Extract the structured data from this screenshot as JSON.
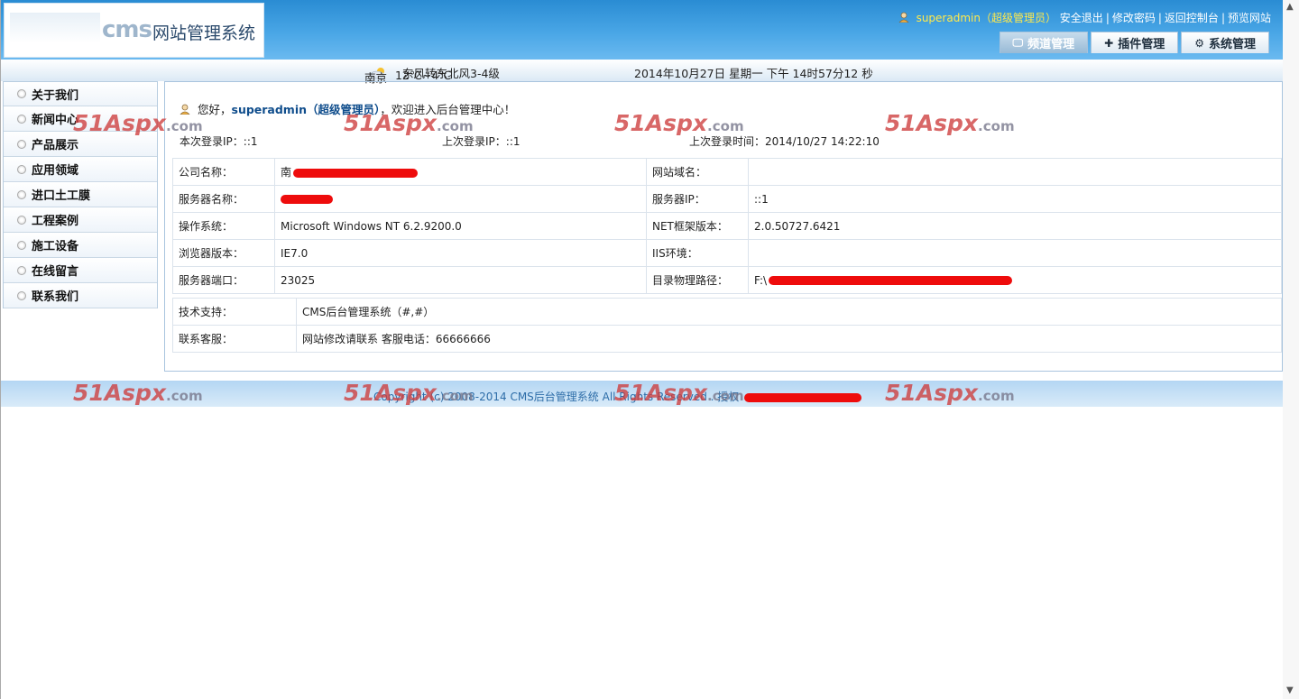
{
  "header": {
    "logo_cms": "cms",
    "logo_title": "网站管理系统",
    "user_name": "superadmin（超级管理员）",
    "links": [
      "安全退出",
      "修改密码",
      "返回控制台",
      "预览网站"
    ],
    "tabs": [
      "频道管理",
      "插件管理",
      "系统管理"
    ]
  },
  "info_bar": {
    "city": "南京",
    "temperature": "12℃~4℃",
    "wind": "东风转东北风3-4级",
    "datetime": "2014年10月27日 星期一 下午 14时57分12 秒"
  },
  "sidebar": {
    "items": [
      "关于我们",
      "新闻中心",
      "产品展示",
      "应用领域",
      "进口土工膜",
      "工程案例",
      "施工设备",
      "在线留言",
      "联系我们"
    ]
  },
  "main": {
    "greeting_prefix": "您好，",
    "greeting_user": "superadmin（超级管理员）",
    "greeting_suffix": "，欢迎进入后台管理中心！",
    "this_login_ip": "本次登录IP：::1",
    "last_login_ip": "上次登录IP：::1",
    "last_login_time": "上次登录时间：2014/10/27 14:22:10",
    "server": {
      "company_label": "公司名称：",
      "company_value": "南",
      "domain_label": "网站域名：",
      "domain_value": "",
      "server_name_label": "服务器名称：",
      "server_name_value": "",
      "server_ip_label": "服务器IP：",
      "server_ip_value": "::1",
      "os_label": "操作系统：",
      "os_value": "Microsoft Windows NT 6.2.9200.0",
      "net_label": "NET框架版本：",
      "net_value": "2.0.50727.6421",
      "browser_label": "浏览器版本：",
      "browser_value": "IE7.0",
      "iis_label": "IIS环境：",
      "iis_value": "",
      "port_label": "服务器端口：",
      "port_value": "23025",
      "path_label": "目录物理路径：",
      "path_value": "F:\\"
    },
    "support": {
      "tech_label": "技术支持：",
      "tech_value": "CMS后台管理系统（#,#）",
      "service_label": "联系客服：",
      "service_value": "网站修改请联系 客服电话：66666666"
    }
  },
  "footer": {
    "copyright": "Copyright (c) 2008-2014 CMS后台管理系统 All Rights Reserved . 授权"
  },
  "watermark": {
    "brand": "51Aspx",
    "suffix": ".com"
  }
}
